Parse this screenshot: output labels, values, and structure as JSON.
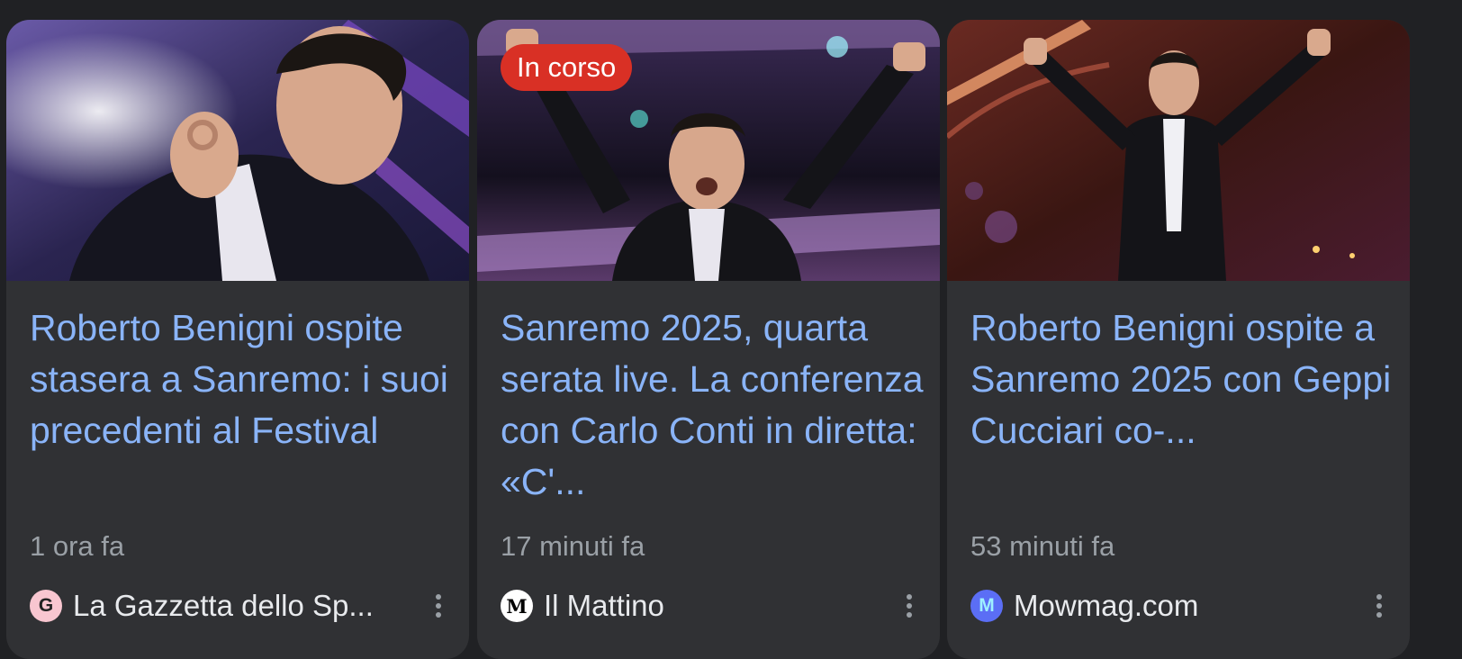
{
  "cards": [
    {
      "title": "Roberto Benigni ospite stasera a Sanremo: i suoi precedenti al Festival",
      "time": "1 ora fa",
      "source": {
        "name": "La Gazzetta dello Sp...",
        "logo_letter": "G",
        "logo_bg": "#f8c6d0",
        "logo_fg": "#222222"
      },
      "image_icon": "photo-roberto-benigni-gesturing"
    },
    {
      "badge": "In corso",
      "title": "Sanremo 2025, quarta serata live. La conferenza con Carlo Conti in diretta: «C'...",
      "time": "17 minuti fa",
      "source": {
        "name": "Il Mattino",
        "logo_letter": "M",
        "logo_bg": "#ffffff",
        "logo_fg": "#000000"
      },
      "image_icon": "photo-roberto-benigni-arms-raised"
    },
    {
      "title": "Roberto Benigni ospite a Sanremo 2025 con Geppi Cucciari co-...",
      "time": "53 minuti fa",
      "source": {
        "name": "Mowmag.com",
        "logo_letter": "M",
        "logo_bg": "#5b6ef5",
        "logo_fg": "#9ef0ff"
      },
      "image_icon": "photo-roberto-benigni-on-stage"
    }
  ],
  "colors": {
    "background": "#202124",
    "card": "#303134",
    "title": "#8ab4f8",
    "meta": "#9aa0a6",
    "badge": "#d93025"
  },
  "more_icon": "more-vert-icon"
}
